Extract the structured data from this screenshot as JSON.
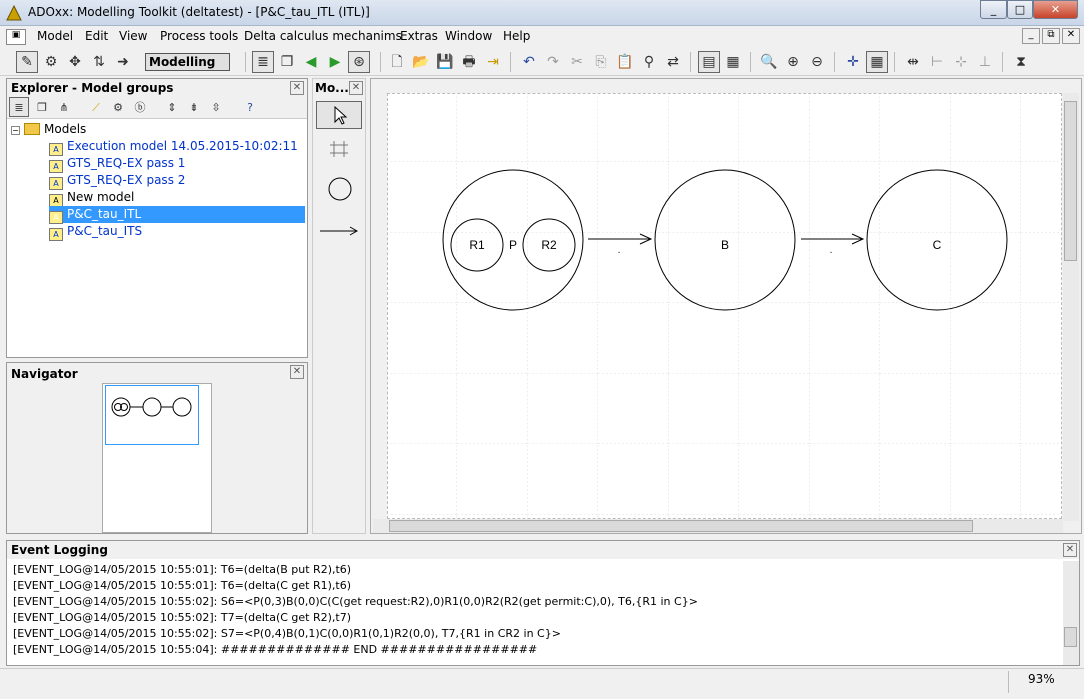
{
  "window": {
    "title": "ADOxx: Modelling Toolkit (deltatest) - [P&C_tau_ITL (ITL)]",
    "min": "_",
    "max": "□",
    "close": "✕"
  },
  "menu": [
    "Model",
    "Edit",
    "View",
    "Process tools",
    "Delta calculus mechanims",
    "Extras",
    "Window",
    "Help"
  ],
  "mdi": {
    "min": "_",
    "restore": "⧉",
    "close": "✕"
  },
  "toolbar": {
    "mode": "Modelling"
  },
  "explorer": {
    "title": "Explorer - Model groups",
    "root": "Models",
    "items": [
      {
        "label": "Execution model 14.05.2015-10:02:11"
      },
      {
        "label": "GTS_REQ-EX pass 1"
      },
      {
        "label": "GTS_REQ-EX pass 2"
      },
      {
        "label": "New model"
      },
      {
        "label": "P&C_tau_ITL"
      },
      {
        "label": "P&C_tau_ITS"
      }
    ]
  },
  "navigator": {
    "title": "Navigator"
  },
  "mo": {
    "title": "Mo..."
  },
  "diagram": {
    "nodes": [
      {
        "label": "P",
        "inner": [
          "R1",
          "R2"
        ]
      },
      {
        "label": "B"
      },
      {
        "label": "C"
      }
    ],
    "edge_labels": [
      ".",
      "."
    ]
  },
  "eventlog": {
    "title": "Event Logging",
    "lines": [
      "[EVENT_LOG@14/05/2015 10:55:01]: T6=(delta(B put R2),t6)",
      "[EVENT_LOG@14/05/2015 10:55:01]: T6=(delta(C get R1),t6)",
      "[EVENT_LOG@14/05/2015 10:55:02]: S6=<P(0,3)B(0,0)C(C(get request:R2),0)R1(0,0)R2(R2(get permit:C),0), T6,{R1 in C}>",
      "[EVENT_LOG@14/05/2015 10:55:02]: T7=(delta(C get R2),t7)",
      "[EVENT_LOG@14/05/2015 10:55:02]: S7=<P(0,4)B(0,1)C(0,0)R1(0,1)R2(0,0), T7,{R1 in CR2 in C}>",
      "[EVENT_LOG@14/05/2015 10:55:04]: ############## END #################"
    ]
  },
  "status": {
    "zoom": "93%"
  }
}
